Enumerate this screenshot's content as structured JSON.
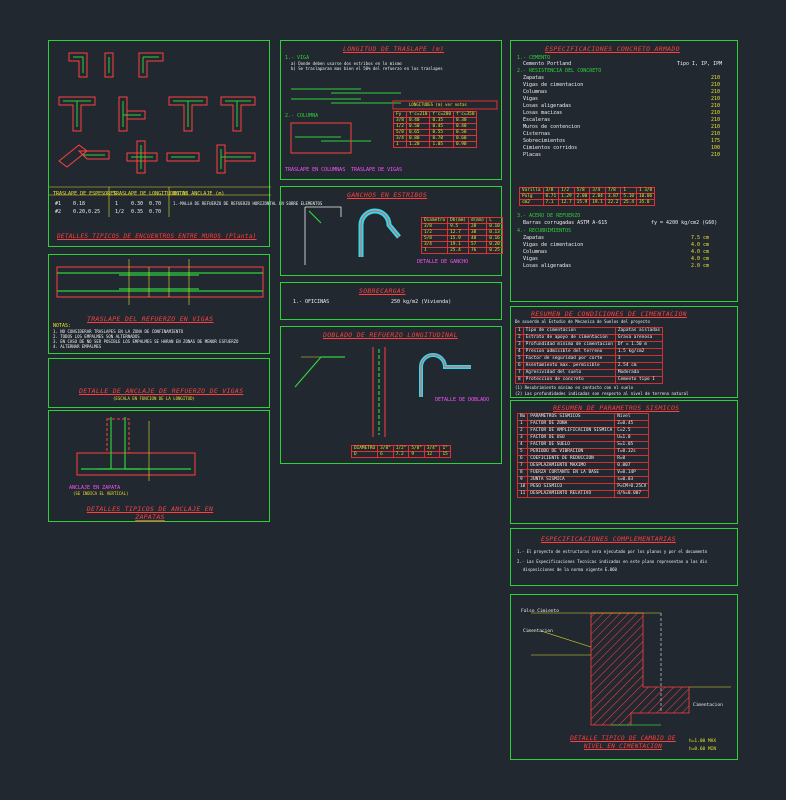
{
  "panels": {
    "muros": {
      "title": "DETALLES TIPICOS DE ENCUENTROS ENTRE MUROS (Planta)",
      "table_header": [
        "TRASLAPE DE ESPESORES",
        "TRASLAPE DE LONGITUDES DE ANCLAJE (m)",
        "NOTAS"
      ],
      "table_rows": [
        [
          "#1",
          "0.18",
          "1",
          "0.30",
          "0.70"
        ],
        [
          "#2",
          "0.20,0.25",
          "1/2",
          "0.35",
          "0.70"
        ]
      ],
      "notes": "1.-MALLA DE REFUERZO DE REFUERZO HORIZONTAL EN SOBRE ELEMENTOS"
    },
    "traslape_vigas": {
      "title": "TRASLAPE DEL REFUERZO EN VIGAS",
      "notes_header": "NOTAS:",
      "notes": [
        "1. NO CONSIDERAR TRASLAPES EN LA ZONA DE CONFINAMIENTO",
        "2. TODOS LOS EMPALMES SON ALTERNADOS",
        "3. EN CASO DE NO SER POSIBLE LOS EMPALMES SE HARAN EN ZONAS DE MENOR ESFUERZO",
        "4. ALTERNAR EMPALMES"
      ]
    },
    "anclaje_vigas": {
      "title": "DETALLE DE ANCLAJE DE REFUERZO DE VIGAS",
      "subtitle": "(ESCALA EN FUNCION DE LA LONGITUD)"
    },
    "zapatas": {
      "title": "DETALLES TIPICOS DE ANCLAJE EN ZAPATAS",
      "label1": "ANCLAJE EN ZAPATA",
      "label2": "(SE INDICA EL VERTICAL)"
    },
    "traslape": {
      "title": "LONGITUD DE TRASLAPE (m)",
      "item1": "1.- VIGA",
      "item2": "2.- COLUMNA",
      "text_a": "a) Donde deben usarse dos estribos en lo mismo",
      "text_b": "b) Se traslaparan mas bien el 50% del refuerzo en los traslapes",
      "table_title": "LONGITUDES (m) ver notas",
      "col_headers": [
        "Fy",
        "f'c=210",
        "f'c=280",
        "f'c=350"
      ],
      "rows": [
        [
          "3/8",
          "0.40",
          "0.35",
          "0.30"
        ],
        [
          "1/2",
          "0.50",
          "0.45",
          "0.40"
        ],
        [
          "5/8",
          "0.65",
          "0.55",
          "0.50"
        ],
        [
          "3/4",
          "0.80",
          "0.70",
          "0.60"
        ],
        [
          "1",
          "1.20",
          "1.05",
          "0.90"
        ]
      ],
      "caption_left": "TRASLAPE EN COLUMNAS",
      "caption_right": "TRASLAPE DE VIGAS"
    },
    "ganchos": {
      "title": "GANCHOS EN ESTRIBOS",
      "caption": "DETALLE DE GANCHO",
      "header": [
        "Diametro",
        "Db(mm)",
        "d(mm)",
        "L"
      ],
      "rows": [
        [
          "3/8",
          "9.5",
          "28",
          "0.10"
        ],
        [
          "1/2",
          "12.7",
          "38",
          "0.13"
        ],
        [
          "5/8",
          "15.9",
          "48",
          "0.16"
        ],
        [
          "3/4",
          "19.1",
          "57",
          "0.20"
        ],
        [
          "1",
          "25.4",
          "76",
          "0.25"
        ]
      ]
    },
    "sobrecargas": {
      "title": "SOBRECARGAS",
      "row": "1.- OFICINAS",
      "value": "250 kg/m2 (Vivienda)"
    },
    "doblado": {
      "title": "DOBLADO DE REFUERZO LONGITUDINAL",
      "caption": "DETALLE DE DOBLADO",
      "table_header": [
        "DIAMETRO",
        "3/8\"",
        "1/2\"",
        "5/8\"",
        "3/4\"",
        "1\""
      ],
      "table_row": [
        "D",
        "6",
        "7.2",
        "9",
        "12",
        "15"
      ]
    },
    "concreto": {
      "title": "ESPECIFICACIONES CONCRETO ARMADO",
      "s1": "1.- CEMENTO",
      "s1a": "Cemento Portland",
      "s1v": "Tipo I, IP, IPM",
      "s2": "2.- RESISTENCIA DEL CONCRETO",
      "items": [
        "Zapatas",
        "Vigas de cimentacion",
        "Columnas",
        "Vigas",
        "Losas aligeradas",
        "Losas macizas",
        "Escaleras",
        "Muros de contencion",
        "Cisternas",
        "Sobrecimientos",
        "Cimientos corridos",
        "Placas"
      ],
      "items_values": [
        "210",
        "210",
        "210",
        "210",
        "210",
        "210",
        "210",
        "210",
        "210",
        "175",
        "100",
        "210"
      ],
      "table_header": [
        "Varilla",
        "3/8",
        "1/2",
        "5/8",
        "3/4",
        "7/8",
        "1",
        "1 3/8"
      ],
      "table_rows": [
        [
          "Pulg",
          "0.71",
          "1.29",
          "2.00",
          "2.84",
          "3.87",
          "5.10",
          "10.06"
        ],
        [
          "cm2",
          "7.1",
          "12.7",
          "15.9",
          "19.1",
          "22.2",
          "25.4",
          "35.8"
        ]
      ],
      "s3": "3.- ACERO DE REFUERZO",
      "s3a": "Barras corrugadas ASTM A-615",
      "s3v": "fy = 4200 kg/cm2 (G60)",
      "s4": "4.- RECUBRIMIENTOS",
      "rec_items": [
        "Zapatas",
        "Vigas de cimentacion",
        "Columnas",
        "Vigas",
        "Losas aligeradas"
      ],
      "rec_values": [
        "7.5 cm",
        "4.0 cm",
        "4.0 cm",
        "4.0 cm",
        "2.0 cm"
      ]
    },
    "cimentacion": {
      "title": "RESUMEN DE CONDICIONES DE CIMENTACION",
      "intro": "De acuerdo al Estudio de Mecanica de Suelos del proyecto",
      "rows": [
        [
          "1",
          "Tipo de cimentacion",
          "Zapatas aisladas"
        ],
        [
          "2",
          "Estrato de apoyo de cimentacion",
          "Grava arenosa"
        ],
        [
          "3",
          "Profundidad minima de cimentacion",
          "Df = 1.50 m"
        ],
        [
          "4",
          "Presion admisible del terreno",
          "1.5 kg/cm2"
        ],
        [
          "5",
          "Factor de seguridad por corte",
          "3"
        ],
        [
          "6",
          "Asentamiento max. permisible",
          "2.54 cm"
        ],
        [
          "7",
          "Agresividad del suelo",
          "Moderada"
        ],
        [
          "8",
          "Proteccion de concreto",
          "Cemento tipo I"
        ]
      ],
      "notes": [
        "(1) Recubrimiento minimo en contacto con el suelo",
        "(2) Las profundidades indicadas son respecto al nivel de terreno natural"
      ]
    },
    "sismicos": {
      "title": "RESUMEN DE PARAMETROS SISMICOS",
      "header": [
        "No",
        "PARAMETROS SISMICOS",
        "Nivel"
      ],
      "rows": [
        [
          "1",
          "FACTOR DE ZONA",
          "Z=0.45"
        ],
        [
          "2",
          "FACTOR DE AMPLIFICACION SISMICA",
          "C=2.5"
        ],
        [
          "3",
          "FACTOR DE USO",
          "U=1.0"
        ],
        [
          "4",
          "FACTOR DE SUELO",
          "S=1.05"
        ],
        [
          "5",
          "PERIODO DE VIBRACION",
          "T=0.32s"
        ],
        [
          "6",
          "COEFICIENTE DE REDUCCION",
          "R=8"
        ],
        [
          "7",
          "DESPLAZAMIENTO MAXIMO",
          "0.007"
        ],
        [
          "8",
          "FUERZA CORTANTE EN LA BASE",
          "V=0.14P"
        ],
        [
          "9",
          "JUNTA SISMICA",
          "s=0.03"
        ],
        [
          "10",
          "PESO SISMICO",
          "P=CM+0.25CV"
        ],
        [
          "11",
          "DESPLAZAMIENTO RELATIVO",
          "d/h=0.007"
        ]
      ]
    },
    "complementarias": {
      "title": "ESPECIFICACIONES COMPLEMENTARIAS",
      "items": [
        "1.- El proyecto de estructuras sera ejecutado por los planos y por el documento",
        "2.- Las Especificaciones Tecnicas indicadas en este plano representan a las dis",
        "disposiciones de la norma vigente E.060"
      ]
    },
    "nivel": {
      "title": "DETALLE TIPICO DE CAMBIO DE NIVEL EN CIMENTACION",
      "label_top": "Falso Cimiento",
      "label_mid": "Cimentacion",
      "label_right": "Cimentacion",
      "note": "h=1.00 MAX",
      "note2": "h=0.60 MIN"
    }
  },
  "colors": {
    "border": "#2fd03a",
    "title": "#ff4040",
    "text_yellow": "#e8e030",
    "text_white": "#f0f0f0",
    "accent_magenta": "#ff50ff",
    "accent_cyan": "#3ad6e8",
    "background": "#212830"
  }
}
